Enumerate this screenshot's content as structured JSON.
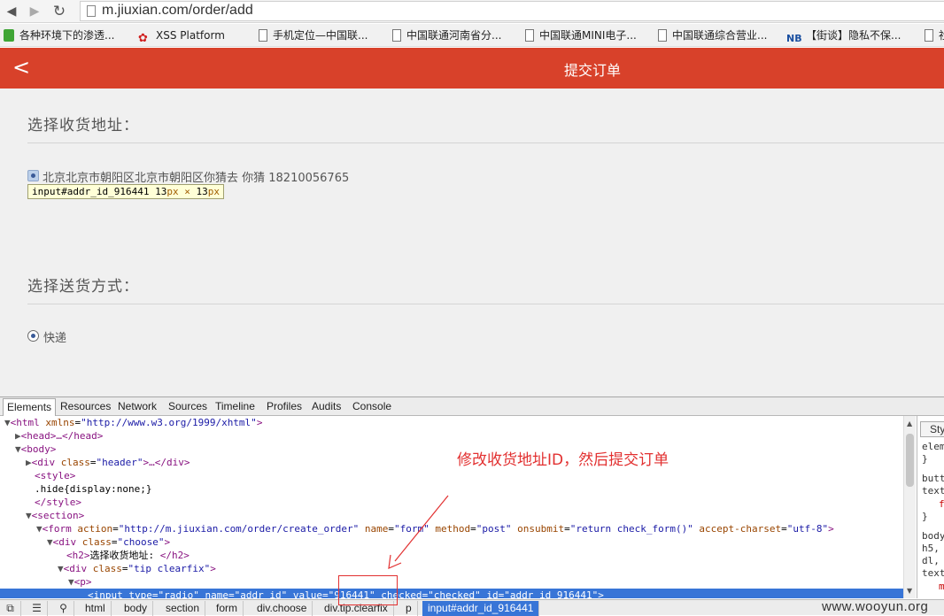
{
  "browser": {
    "url": "m.jiuxian.com/order/add",
    "bookmarks": [
      {
        "label": "各种环境下的渗透...",
        "icon": "green"
      },
      {
        "label": "XSS Platform",
        "icon": "flower"
      },
      {
        "label": "手机定位—中国联...",
        "icon": "page"
      },
      {
        "label": "中国联通河南省分...",
        "icon": "page"
      },
      {
        "label": "中国联通MINI电子...",
        "icon": "page"
      },
      {
        "label": "中国联通综合营业...",
        "icon": "page"
      },
      {
        "label": "【街谈】隐私不保...",
        "icon": "nb",
        "icon_text": "NB"
      },
      {
        "label": "社",
        "icon": "page"
      }
    ]
  },
  "header": {
    "back_glyph": "<",
    "title": "提交订单",
    "bg_color": "#d8412a"
  },
  "address": {
    "heading": "选择收货地址：",
    "option_text": "北京北京市朝阳区北京市朝阳区你猜去 你猜 18210056765",
    "tooltip_selector": "input#addr_id_916441",
    "tooltip_w": "13",
    "tooltip_x": "×",
    "tooltip_h": "13",
    "tooltip_unit": "px"
  },
  "delivery": {
    "heading": "选择送货方式：",
    "option_text": "快递"
  },
  "devtools": {
    "tabs": [
      "Elements",
      "Resources",
      "Network",
      "Sources",
      "Timeline",
      "Profiles",
      "Audits",
      "Console"
    ],
    "dom": {
      "html_open": "<html",
      "html_attr": " xmlns",
      "html_val": "\"http://www.w3.org/1999/xhtml\"",
      "head": "<head>…</head>",
      "body": "<body>",
      "div_header_tag": "<div",
      "div_header_attr": " class",
      "div_header_val": "\"header\"",
      "div_header_end": ">…</div>",
      "style_open": "<style>",
      "style_text": ".hide{display:none;}",
      "style_close": "</style>",
      "section": "<section>",
      "form_tag": "<form",
      "form_a1": " action",
      "form_v1": "\"http://m.jiuxian.com/order/create_order\"",
      "form_a2": " name",
      "form_v2": "\"form\"",
      "form_a3": " method",
      "form_v3": "\"post\"",
      "form_a4": " onsubmit",
      "form_v4": "\"return check_form()\"",
      "form_a5": " accept-charset",
      "form_v5": "\"utf-8\"",
      "choose_tag": "<div",
      "choose_attr": " class",
      "choose_val": "\"choose\"",
      "h2_open": "<h2>",
      "h2_text": "选择收货地址: ",
      "h2_close": "</h2>",
      "tip_tag": "<div",
      "tip_attr": " class",
      "tip_val": "\"tip clearfix\"",
      "p_open": "<p>",
      "input_tag": "<input",
      "input_a1": " type",
      "input_v1": "\"radio\"",
      "input_a2": " name",
      "input_v2": "\"addr_id\"",
      "input_a3": " value",
      "input_v3": "\"916441\"",
      "input_a4": " checked",
      "input_v4": "\"checked\"",
      "input_a5": " id",
      "input_v5": "\"addr_id_916441\""
    },
    "styles_tab": "Sty",
    "styles_lines": [
      "elem",
      "}",
      "butt",
      "text",
      "f",
      "}",
      "body",
      "h5,",
      "dl,",
      "text",
      "m"
    ],
    "breadcrumbs": [
      "html",
      "body",
      "section",
      "form",
      "div.choose",
      "div.tip.clearfix",
      "p",
      "input#addr_id_916441"
    ]
  },
  "annotation": {
    "text": "修改收货地址ID，然后提交订单",
    "color": "#e23030"
  },
  "watermark": "www.wooyun.org"
}
